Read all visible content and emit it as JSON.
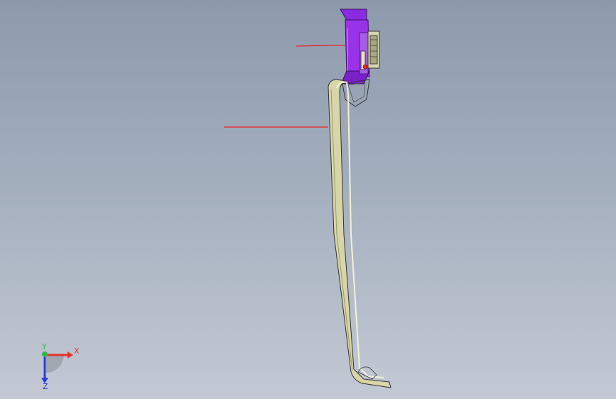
{
  "viewport": {
    "background_top": "#8d9aac",
    "background_bottom": "#c3c9d4"
  },
  "model": {
    "assembly_color": "#8a2be2",
    "handle_color": "#d4d3a4",
    "leader_color": "#ff0000"
  },
  "triad": {
    "x_label": "X",
    "y_label": "Y",
    "z_label": "Z",
    "x_color": "#e8322a",
    "y_color": "#2fb84a",
    "z_color": "#2a3cd8"
  }
}
